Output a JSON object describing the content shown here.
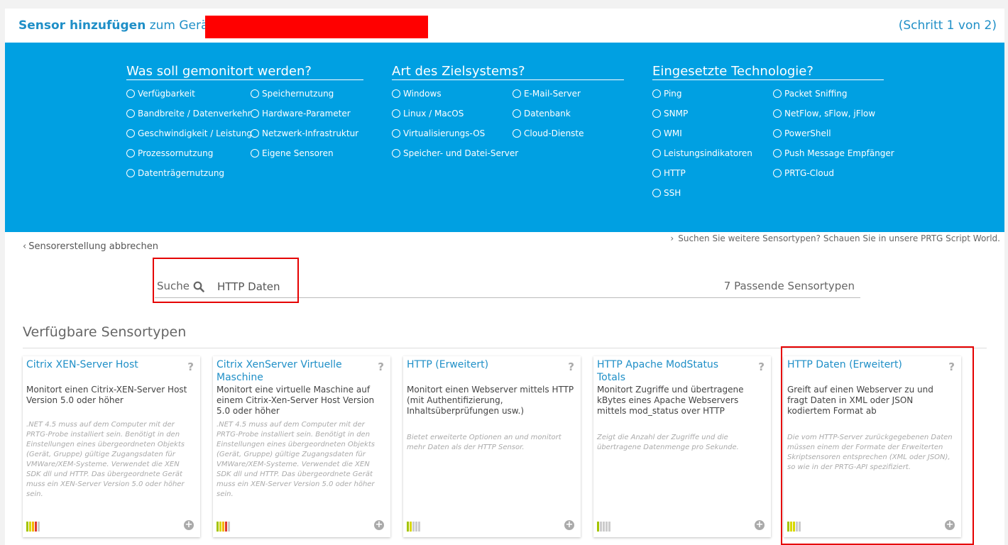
{
  "header": {
    "title_bold": "Sensor hinzufügen",
    "title_rest": "zum Gerät",
    "step": "(Schritt 1 von 2)"
  },
  "filters": [
    {
      "heading": "Was soll gemonitort werden?",
      "columns": [
        [
          "Verfügbarkeit",
          "Bandbreite / Datenverkehr",
          "Geschwindigkeit / Leistung",
          "Prozessornutzung",
          "Datenträgernutzung"
        ],
        [
          "Speichernutzung",
          "Hardware-Parameter",
          "Netzwerk-Infrastruktur",
          "Eigene Sensoren"
        ]
      ]
    },
    {
      "heading": "Art des Zielsystems?",
      "columns": [
        [
          "Windows",
          "Linux / MacOS",
          "Virtualisierungs-OS",
          "Speicher- und Datei-Server"
        ],
        [
          "E-Mail-Server",
          "Datenbank",
          "Cloud-Dienste"
        ]
      ]
    },
    {
      "heading": "Eingesetzte Technologie?",
      "columns": [
        [
          "Ping",
          "SNMP",
          "WMI",
          "Leistungsindikatoren",
          "HTTP",
          "SSH"
        ],
        [
          "Packet Sniffing",
          "NetFlow, sFlow, jFlow",
          "PowerShell",
          "Push Message Empfänger",
          "PRTG-Cloud"
        ]
      ]
    }
  ],
  "nav": {
    "cancel": "Sensorerstellung abbrechen",
    "script_world": "Suchen Sie weitere Sensortypen? Schauen Sie in unsere PRTG Script World."
  },
  "search": {
    "label": "Suche",
    "value": "HTTP Daten",
    "count": "7",
    "count_label": "Passende Sensortypen"
  },
  "section_title": "Verfügbare Sensortypen",
  "cards": [
    {
      "title": "Citrix XEN-Server Host",
      "desc": "Monitort einen Citrix-XEN-Server Host Version 5.0 oder höher",
      "note": ".NET 4.5 muss auf dem Computer mit der PRTG-Probe installiert sein. Benötigt in den Einstellungen eines übergeordneten Objekts (Gerät, Gruppe) gültige Zugangsdaten für VMWare/XEM-Systeme. Verwendet die XEN SDK dll und HTTP. Das übergeordnete Gerät muss ein XEN-Server Version 5.0 oder höher sein.",
      "bars": [
        "#a4c400",
        "#d8d800",
        "#f5b400",
        "#e03a2f",
        "#cccccc"
      ]
    },
    {
      "title": "Citrix XenServer Virtuelle Maschine",
      "desc": "Monitort eine virtuelle Maschine auf einem Citrix-Xen-Server Host Version 5.0 oder höher",
      "note": ".NET 4.5 muss auf dem Computer mit der PRTG-Probe installiert sein. Benötigt in den Einstellungen eines übergeordneten Objekts (Gerät, Gruppe) gültige Zugangsdaten für VMWare/XEM-Systeme. Verwendet die XEN SDK dll und HTTP. Das übergeordnete Gerät muss ein XEN-Server Version 5.0 oder höher sein.",
      "bars": [
        "#a4c400",
        "#d8d800",
        "#f5b400",
        "#e03a2f",
        "#cccccc"
      ]
    },
    {
      "title": "HTTP (Erweitert)",
      "desc": "Monitort einen Webserver mittels HTTP (mit Authentifizierung, Inhaltsüberprüfungen usw.)",
      "note": "Bietet erweiterte Optionen an und monitort mehr Daten als der HTTP Sensor.",
      "bars": [
        "#a4c400",
        "#d8d800",
        "#cccccc",
        "#cccccc",
        "#cccccc"
      ]
    },
    {
      "title": "HTTP Apache ModStatus Totals",
      "desc": "Monitort Zugriffe und übertragene kBytes eines Apache Webservers mittels mod_status over HTTP",
      "note": "Zeigt die Anzahl der Zugriffe und die übertragene Datenmenge pro Sekunde.",
      "bars": [
        "#a4c400",
        "#cccccc",
        "#cccccc",
        "#cccccc",
        "#cccccc"
      ]
    },
    {
      "title": "HTTP Daten (Erweitert)",
      "desc": "Greift auf einen Webserver zu und fragt Daten in XML oder JSON kodiertem Format ab",
      "note": "Die vom HTTP-Server zurückgegebenen Daten müssen einem der Formate der Erweiterten Skriptsensoren entsprechen (XML oder JSON), so wie in der PRTG-API spezifiziert.",
      "bars": [
        "#a4c400",
        "#d8d800",
        "#d8d800",
        "#cccccc",
        "#cccccc"
      ]
    }
  ],
  "colors": {
    "accent": "#1f8fc7",
    "filter_bg": "#00a0e2",
    "highlight": "#e50000",
    "redaction": "#ff0000"
  },
  "icons": {
    "search": "search-icon",
    "help": "help-icon",
    "add": "add-icon"
  }
}
